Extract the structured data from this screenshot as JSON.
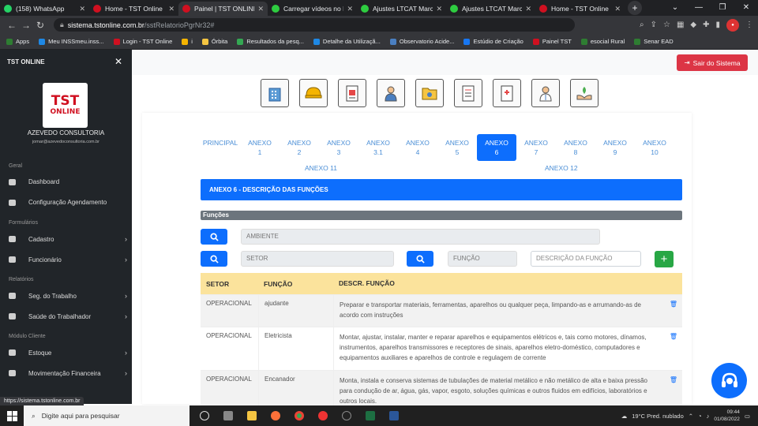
{
  "browser": {
    "tabs": [
      {
        "title": "(158) WhatsApp",
        "color": "#25d366"
      },
      {
        "title": "Home - TST Online",
        "color": "#d01020"
      },
      {
        "title": "Painel | TST ONLINE",
        "color": "#d01020",
        "active": true
      },
      {
        "title": "Carregar vídeos no Fi",
        "color": "#2ecc40"
      },
      {
        "title": "Ajustes LTCAT Marcio",
        "color": "#2ecc40"
      },
      {
        "title": "Ajustes LTCAT Marcio",
        "color": "#2ecc40"
      },
      {
        "title": "Home - TST Online",
        "color": "#d01020"
      }
    ],
    "url_host": "sistema.tstonline.com.br",
    "url_path": "/sstRelatorioPgrNr32#",
    "bookmarks": [
      "Apps",
      "Meu INSSmeu.inss...",
      "Login - TST Online",
      "i",
      "Órbita",
      "Resultados da pesq...",
      "Detalhe da Utilizaçã...",
      "Observatorio Acide...",
      "Estúdio de Criação",
      "Painel TST",
      "esocial Rural",
      "Senar EAD"
    ]
  },
  "sidebar": {
    "brand": "TST ONLINE",
    "logo_line1": "TST",
    "logo_line2": "ONLINE",
    "company": "AZEVEDO CONSULTORIA",
    "email": "jomar@azevedoconsultoria.com.br",
    "sections": [
      {
        "label": "Geral",
        "items": [
          {
            "label": "Dashboard",
            "chevron": false
          },
          {
            "label": "Configuração Agendamento",
            "chevron": false
          }
        ]
      },
      {
        "label": "Formulários",
        "items": [
          {
            "label": "Cadastro",
            "chevron": true
          },
          {
            "label": "Funcionário",
            "chevron": true
          }
        ]
      },
      {
        "label": "Relatórios",
        "items": [
          {
            "label": "Seg. do Trabalho",
            "chevron": true
          },
          {
            "label": "Saúde do Trabalhador",
            "chevron": true
          }
        ]
      },
      {
        "label": "Módulo Cliente",
        "items": [
          {
            "label": "Estoque",
            "chevron": true
          },
          {
            "label": "Movimentação Financeira",
            "chevron": true
          }
        ]
      }
    ]
  },
  "topnav": {
    "logout_label": "Sair do Sistema"
  },
  "anexo_tabs": [
    {
      "l1": "PRINCIPAL",
      "l2": ""
    },
    {
      "l1": "ANEXO",
      "l2": "1"
    },
    {
      "l1": "ANEXO",
      "l2": "2"
    },
    {
      "l1": "ANEXO",
      "l2": "3"
    },
    {
      "l1": "ANEXO",
      "l2": "3.1"
    },
    {
      "l1": "ANEXO",
      "l2": "4"
    },
    {
      "l1": "ANEXO",
      "l2": "5"
    },
    {
      "l1": "ANEXO",
      "l2": "6"
    },
    {
      "l1": "ANEXO",
      "l2": "7"
    },
    {
      "l1": "ANEXO",
      "l2": "8"
    },
    {
      "l1": "ANEXO",
      "l2": "9"
    },
    {
      "l1": "ANEXO",
      "l2": "10"
    }
  ],
  "anexo_row2": [
    "ANEXO 11",
    "ANEXO 12"
  ],
  "section_title": "ANEXO 6 - DESCRIÇÃO DAS FUNÇÕES",
  "subsection_title": "Funções",
  "filters": {
    "ambiente_placeholder": "AMBIENTE",
    "setor_placeholder": "SETOR",
    "funcao_placeholder": "FUNÇÃO",
    "descricao_placeholder": "DESCRIÇÃO DA FUNÇÃO"
  },
  "table": {
    "headers": [
      "SETOR",
      "FUNÇÃO",
      "DESCR. FUNÇÃO"
    ],
    "rows": [
      {
        "setor": "OPERACIONAL",
        "funcao": "ajudante",
        "descricao": "Preparar e transportar materiais, ferramentas, aparelhos ou qualquer peça, limpando-as e arrumando-as de acordo com instruções"
      },
      {
        "setor": "OPERACIONAL",
        "funcao": "Eletricista",
        "descricao": "Montar, ajustar, instalar, manter e reparar aparelhos e equipamentos elétricos e, tais como motores, dínamos, instrumentos, aparelhos transmissores e receptores de sinais, aparelhos eletro-doméstico, computadores e equipamentos auxiliares e aparelhos de controle e regulagem de corrente"
      },
      {
        "setor": "OPERACIONAL",
        "funcao": "Encanador",
        "descricao": "Monta, instala e conserva sistemas de tubulações de material metálico e não metálico de alta e baixa pressão para condução de ar, água, gás, vapor, esgoto, soluções químicas e outros fluidos em edifícios, laboratórios e outros locais."
      }
    ]
  },
  "status_url": "https://sistema.tstonline.com.br",
  "taskbar": {
    "search_placeholder": "Digite aqui para pesquisar",
    "weather": "19°C  Pred. nublado",
    "time": "09:44",
    "date": "01/08/2022"
  }
}
